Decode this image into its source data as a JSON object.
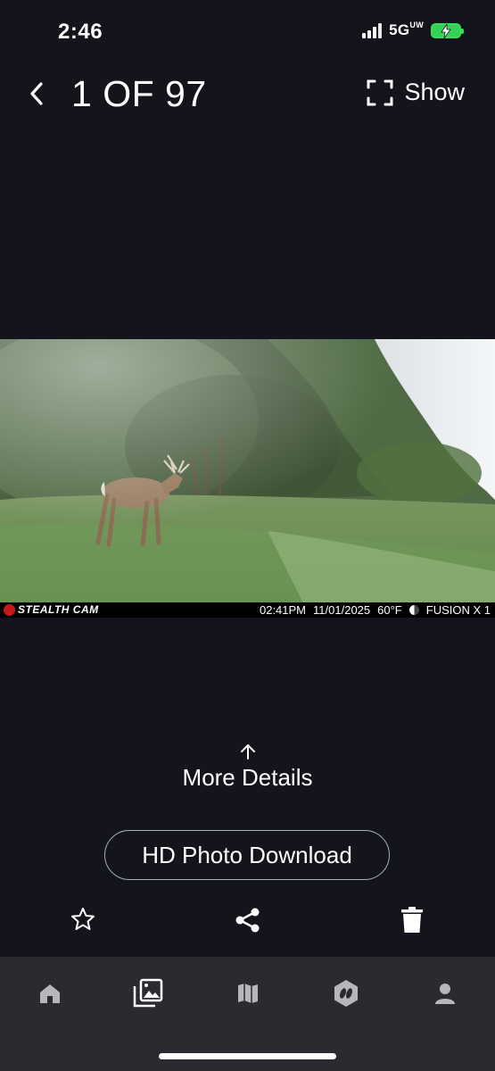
{
  "status": {
    "time": "2:46",
    "network": "5G",
    "network_sup": "UW"
  },
  "header": {
    "counter": "1 OF 97",
    "show_label": "Show"
  },
  "photo": {
    "brand": "STEALTH CAM",
    "time": "02:41PM",
    "date": "11/01/2025",
    "temperature": "60°F",
    "camera": "FUSION X 1"
  },
  "details": {
    "more_label": "More Details",
    "hd_download_label": "HD Photo Download"
  },
  "actions": {
    "favorite_icon": "star-icon",
    "share_icon": "share-icon",
    "delete_icon": "trash-icon"
  },
  "tabbar": {
    "tabs": [
      {
        "icon": "home-icon"
      },
      {
        "icon": "gallery-icon"
      },
      {
        "icon": "map-icon"
      },
      {
        "icon": "hoof-badge-icon"
      },
      {
        "icon": "profile-icon"
      }
    ]
  },
  "colors": {
    "background": "#13141c",
    "tabbar": "#2a2b31",
    "battery": "#33d158"
  }
}
